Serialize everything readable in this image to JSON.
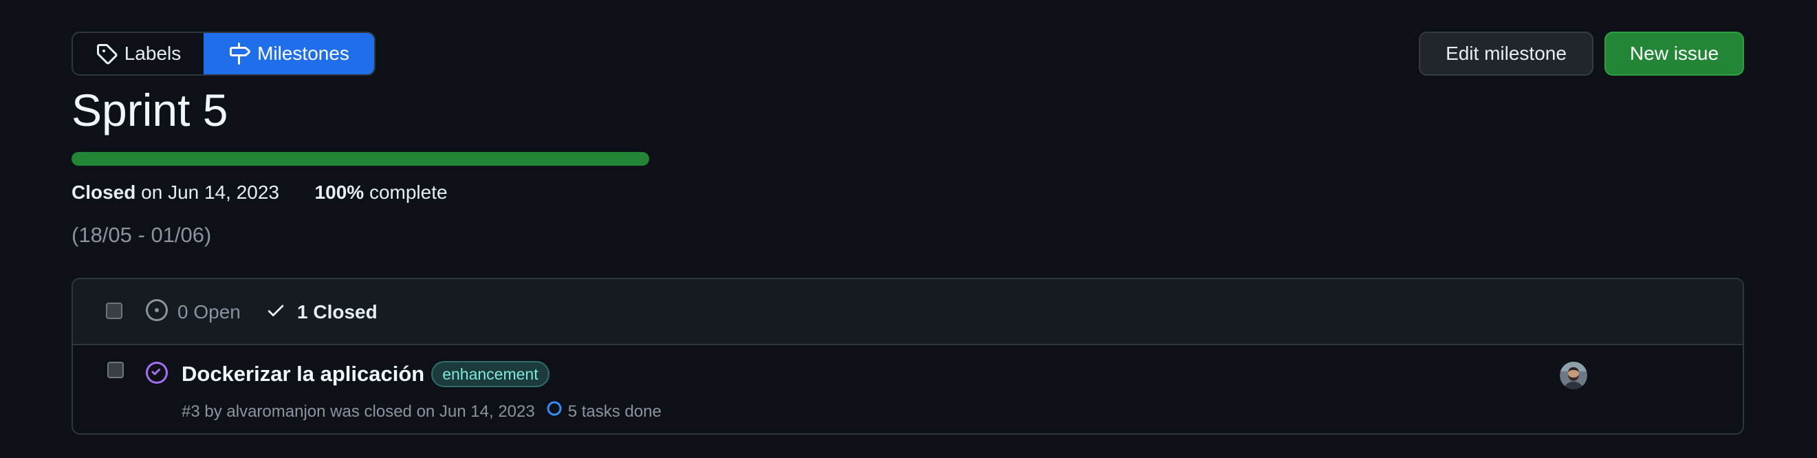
{
  "nav": {
    "labels_label": "Labels",
    "milestones_label": "Milestones",
    "active": "milestones"
  },
  "actions": {
    "edit_label": "Edit milestone",
    "new_label": "New issue"
  },
  "milestone": {
    "title": "Sprint 5",
    "progress_percent": 100,
    "closed_word": "Closed",
    "closed_on": "on Jun 14, 2023",
    "percent_text": "100%",
    "complete_word": "complete",
    "description": "(18/05 - 01/06)"
  },
  "list_header": {
    "open_label": "0 Open",
    "closed_label": "1 Closed"
  },
  "issues": [
    {
      "title": "Dockerizar la aplicación",
      "label": "enhancement",
      "number": "#3",
      "by": "by",
      "author": "alvaromanjon",
      "closed_text": "was closed on Jun 14, 2023",
      "tasks": "5 tasks done"
    }
  ],
  "colors": {
    "background": "#0d1117",
    "accent_blue": "#1f6feb",
    "success_green": "#238636",
    "closed_purple": "#a371f7",
    "label_teal": "#7ee7de"
  },
  "icons": {
    "labels": "tag-icon",
    "milestones": "milestone-signpost-icon",
    "open": "issue-opened-icon",
    "closed": "check-icon",
    "issue_status": "issue-closed-icon",
    "tasks": "progress-ring-icon"
  }
}
